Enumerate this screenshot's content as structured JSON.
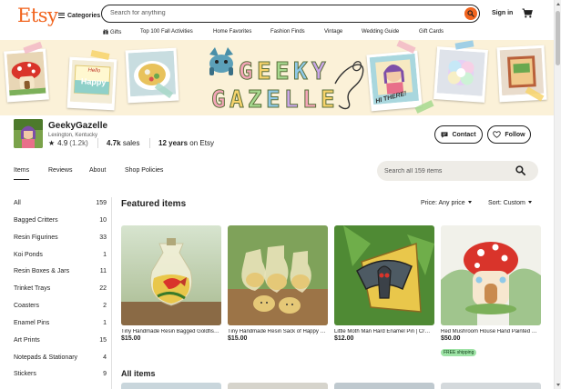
{
  "header": {
    "logo": "Etsy",
    "categories_label": "Categories",
    "search_placeholder": "Search for anything",
    "signin_label": "Sign in"
  },
  "subnav": [
    "Gifts",
    "Top 100 Fall Activities",
    "Home Favorites",
    "Fashion Finds",
    "Vintage",
    "Wedding Guide",
    "Gift Cards"
  ],
  "banner": {
    "note_text": [
      "Hello",
      "Happy"
    ],
    "hi_text": "HI THERE!"
  },
  "shop": {
    "name": "GeekyGazelle",
    "location": "Lexington, Kentucky",
    "rating": "4.9",
    "rating_count": "(1.2k)",
    "sales_value": "4.7k",
    "sales_label": "sales",
    "years_value": "12 years",
    "years_label": "on Etsy",
    "contact_label": "Contact",
    "follow_label": "Follow"
  },
  "tabs": [
    "Items",
    "Reviews",
    "About",
    "Shop Policies"
  ],
  "shop_search_placeholder": "Search all 159 items",
  "sidebar": [
    {
      "label": "All",
      "count": "159"
    },
    {
      "label": "Bagged Critters",
      "count": "10"
    },
    {
      "label": "Resin Figurines",
      "count": "33"
    },
    {
      "label": "Koi Ponds",
      "count": "1"
    },
    {
      "label": "Resin Boxes & Jars",
      "count": "11"
    },
    {
      "label": "Trinket Trays",
      "count": "22"
    },
    {
      "label": "Coasters",
      "count": "2"
    },
    {
      "label": "Enamel Pins",
      "count": "1"
    },
    {
      "label": "Art Prints",
      "count": "15"
    },
    {
      "label": "Notepads & Stationary",
      "count": "4"
    },
    {
      "label": "Stickers",
      "count": "9"
    }
  ],
  "featured": {
    "title": "Featured items",
    "price_filter": "Price: Any price",
    "sort": "Sort: Custom",
    "items": [
      {
        "title": "Tiny Handmade Resin Bagged Goldfish ...",
        "price": "$15.00"
      },
      {
        "title": "Tiny Handmade Resin Sack of Happy P...",
        "price": "$15.00"
      },
      {
        "title": "Little Moth Man Hard Enamel Pin | Cryp...",
        "price": "$12.00"
      },
      {
        "title": "Red Mushroom House Hand Painted R...",
        "price": "$50.00",
        "badge": "FREE shipping"
      }
    ]
  },
  "all_items_title": "All items",
  "colors": {
    "brand": "#F1641E",
    "banner_bg": "#FBF1D8",
    "badge": "#9EE3A6"
  }
}
